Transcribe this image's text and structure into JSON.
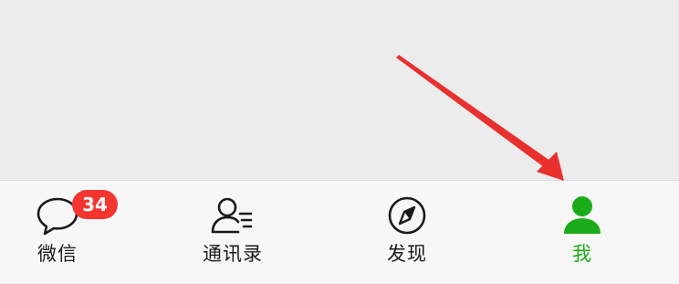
{
  "tab_bar": {
    "tabs": [
      {
        "label": "微信",
        "icon": "chat-bubble-icon",
        "badge": "34",
        "active": false
      },
      {
        "label": "通讯录",
        "icon": "contacts-icon",
        "active": false
      },
      {
        "label": "发现",
        "icon": "compass-icon",
        "active": false
      },
      {
        "label": "我",
        "icon": "person-icon",
        "active": true
      }
    ]
  },
  "colors": {
    "active": "#1aad19",
    "badge": "#f43530",
    "annotation_arrow": "#e8312e"
  }
}
